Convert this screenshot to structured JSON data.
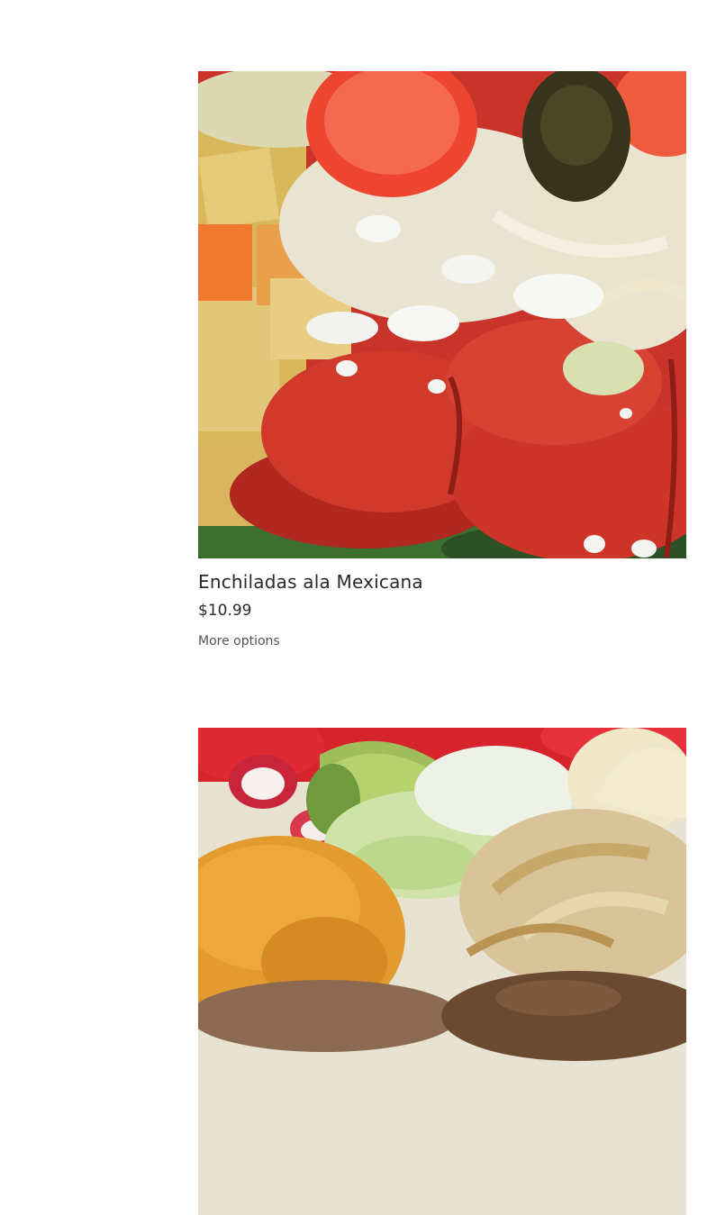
{
  "products": [
    {
      "title": "Enchiladas ala Mexicana",
      "price": "$10.99",
      "options_label": "More options",
      "image_subject": "red enchiladas topped with queso fresco, tomato slices, lettuce and potatoes"
    },
    {
      "title": "",
      "price": "",
      "options_label": "",
      "image_subject": "plate with rice, refried beans, avocado, lettuce, radish, grilled onions, tortillas and carne asada"
    }
  ]
}
